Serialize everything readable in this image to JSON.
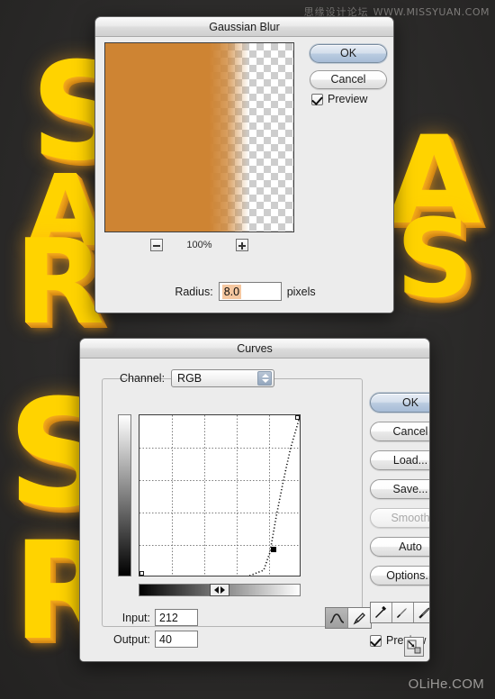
{
  "background": {
    "letters": [
      "S",
      "A",
      "R",
      "A",
      "S",
      "S",
      "R"
    ],
    "letter_color": "#ffd300",
    "shadow_color": "#d28714",
    "canvas_color": "#302f2e"
  },
  "watermarks": {
    "top_cn": "思缘设计论坛",
    "top_url": "WWW.MISSYUAN.COM",
    "bottom": "OLiHe.COM"
  },
  "gaussian_blur": {
    "title": "Gaussian Blur",
    "preview": {
      "fill_color": "#ce8433",
      "zoom_level": "100%",
      "minus_icon": "minus-icon",
      "plus_icon": "plus-icon"
    },
    "radius": {
      "label": "Radius:",
      "value": "8.0",
      "units": "pixels"
    },
    "buttons": {
      "ok": "OK",
      "cancel": "Cancel"
    },
    "preview_checkbox": {
      "label": "Preview",
      "checked": true
    }
  },
  "curves": {
    "title": "Curves",
    "channel": {
      "label": "Channel:",
      "value": "RGB"
    },
    "input": {
      "label": "Input:",
      "value": "212"
    },
    "output": {
      "label": "Output:",
      "value": "40"
    },
    "buttons": {
      "ok": "OK",
      "cancel": "Cancel",
      "load": "Load...",
      "save": "Save...",
      "smooth": "Smooth",
      "auto": "Auto",
      "options": "Options..."
    },
    "preview_checkbox": {
      "label": "Preview",
      "checked": true
    },
    "tools": {
      "curve_tool": "curve-tool-icon",
      "pencil_tool": "pencil-tool-icon",
      "eyedropper_black": "eyedropper-black-icon",
      "eyedropper_gray": "eyedropper-gray-icon",
      "eyedropper_white": "eyedropper-white-icon",
      "resize": "resize-grip-icon"
    },
    "chart_data": {
      "type": "line",
      "title": "Curves",
      "xlabel": "Input",
      "ylabel": "Output",
      "xlim": [
        0,
        255
      ],
      "ylim": [
        0,
        255
      ],
      "grid": true,
      "grid_divisions": 4,
      "control_points": [
        {
          "input": 0,
          "output": 0
        },
        {
          "input": 212,
          "output": 40
        },
        {
          "input": 255,
          "output": 255
        }
      ],
      "selected_point": {
        "input": 212,
        "output": 40
      },
      "series": [
        {
          "name": "RGB",
          "x": [
            0,
            196,
            212,
            222,
            232,
            242,
            255
          ],
          "y": [
            0,
            12,
            40,
            95,
            150,
            205,
            255
          ]
        }
      ]
    }
  }
}
